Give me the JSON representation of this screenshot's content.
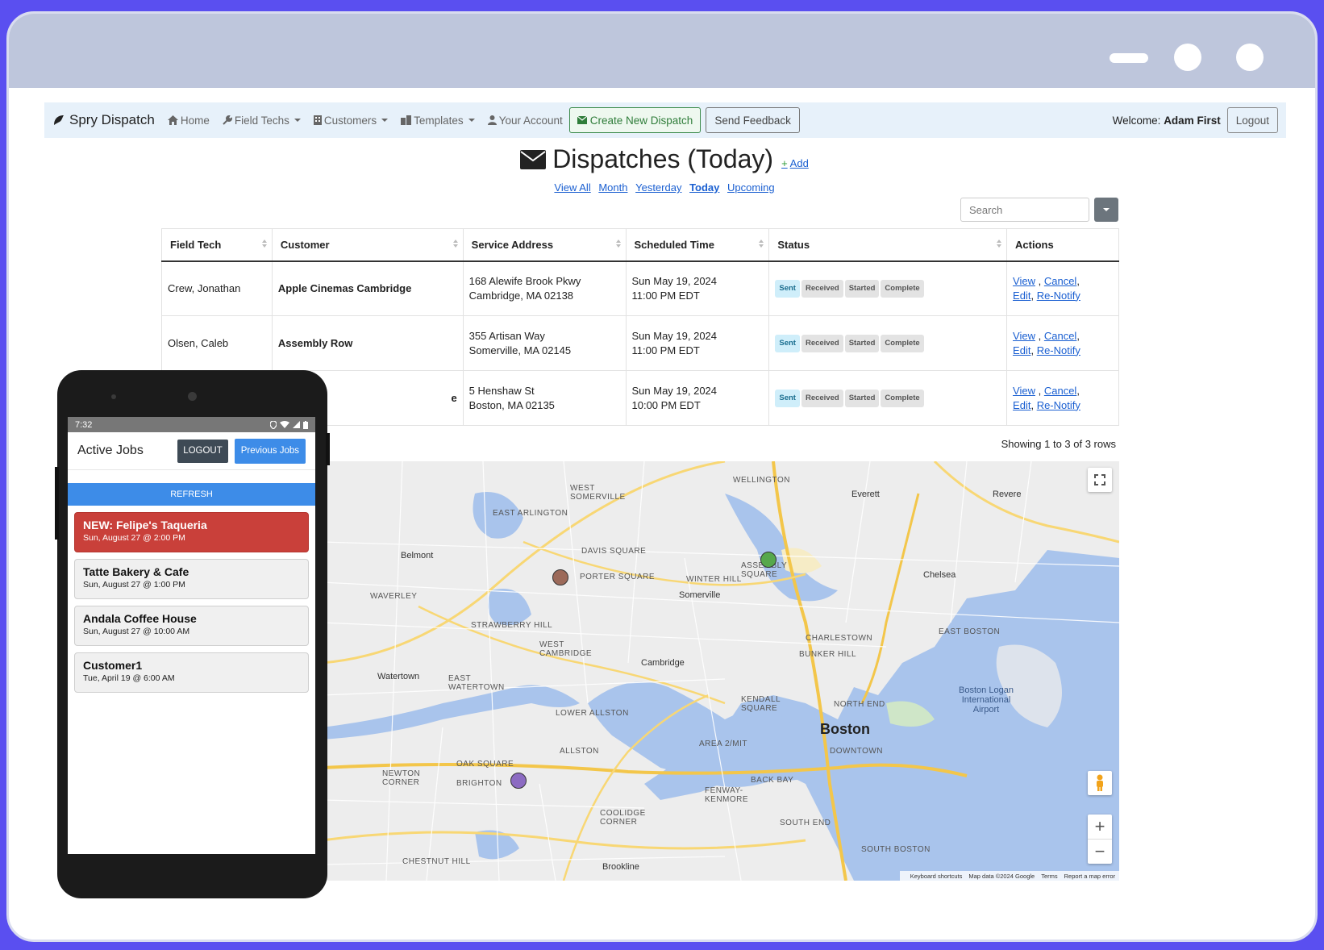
{
  "navbar": {
    "brand": "Spry Dispatch",
    "items": [
      {
        "label": "Home",
        "icon": "home-icon"
      },
      {
        "label": "Field Techs",
        "icon": "wrench-icon"
      },
      {
        "label": "Customers",
        "icon": "building-icon"
      },
      {
        "label": "Templates",
        "icon": "template-icon"
      },
      {
        "label": "Your Account",
        "icon": "user-icon"
      }
    ],
    "create_label": "Create New Dispatch",
    "feedback_label": "Send Feedback",
    "welcome_prefix": "Welcome:",
    "welcome_user": "Adam First",
    "logout_label": "Logout"
  },
  "page": {
    "title": "Dispatches (Today)",
    "add_label": "Add",
    "filters": [
      "View All",
      "Month",
      "Yesterday",
      "Today",
      "Upcoming"
    ],
    "active_filter": "Today"
  },
  "search": {
    "placeholder": "Search"
  },
  "table": {
    "headers": [
      "Field Tech",
      "Customer",
      "Service Address",
      "Scheduled Time",
      "Status",
      "Actions"
    ],
    "rows": [
      {
        "tech": "Crew, Jonathan",
        "customer": "Apple Cinemas Cambridge",
        "addr1": "168 Alewife Brook Pkwy",
        "addr2": "Cambridge, MA 02138",
        "date": "Sun May 19, 2024",
        "time": "11:00 PM EDT"
      },
      {
        "tech": "Olsen, Caleb",
        "customer": "Assembly Row",
        "addr1": "355 Artisan Way",
        "addr2": "Somerville, MA 02145",
        "date": "Sun May 19, 2024",
        "time": "11:00 PM EDT"
      },
      {
        "tech": "",
        "customer": "e",
        "addr1": "5 Henshaw St",
        "addr2": "Boston, MA 02135",
        "date": "Sun May 19, 2024",
        "time": "10:00 PM EDT"
      }
    ],
    "statuses": [
      "Sent",
      "Received",
      "Started",
      "Complete"
    ],
    "actions": {
      "view": "View",
      "cancel": "Cancel",
      "edit": "Edit",
      "renotify": "Re-Notify"
    },
    "showing": "Showing 1 to 3 of 3 rows"
  },
  "map": {
    "labels": {
      "boston": "Boston",
      "cambridge": "Cambridge",
      "somerville": "Somerville",
      "everett": "Everett",
      "chelsea": "Chelsea",
      "revere": "Revere",
      "belmont": "Belmont",
      "watertown": "Watertown",
      "brookline": "Brookline",
      "airport": "Boston Logan International Airport",
      "davis": "DAVIS SQUARE",
      "porter": "PORTER SQUARE",
      "assembly": "ASSEMBLY SQUARE",
      "charlestown": "CHARLESTOWN",
      "kendall": "KENDALL SQUARE",
      "northend": "NORTH END",
      "downtown": "DOWNTOWN",
      "backbay": "BACK BAY",
      "fenway": "FENWAY-KENMORE",
      "allston": "ALLSTON",
      "brighton": "BRIGHTON",
      "southend": "SOUTH END",
      "southboston": "SOUTH BOSTON",
      "eastboston": "EAST BOSTON",
      "wellington": "WELLINGTON",
      "eastarlington": "EAST ARLINGTON",
      "westsomerville": "WEST SOMERVILLE",
      "winterhill": "WINTER HILL",
      "strawberry": "STRAWBERRY HILL",
      "westcambridge": "WEST CAMBRIDGE",
      "lowerallston": "LOWER ALLSTON",
      "eastwatertown": "EAST WATERTOWN",
      "oaksquare": "OAK SQUARE",
      "chestnut": "CHESTNUT HILL",
      "coolidge": "COOLIDGE CORNER",
      "waverley": "WAVERLEY",
      "bunker": "BUNKER HILL",
      "newton": "NEWTON CORNER",
      "mit": "AREA 2/MIT"
    },
    "markers": [
      {
        "name": "marker-brown",
        "color": "#9c6a5a"
      },
      {
        "name": "marker-green",
        "color": "#56a84b"
      },
      {
        "name": "marker-purple",
        "color": "#8c6bc2"
      }
    ],
    "footer": [
      "Keyboard shortcuts",
      "Map data ©2024 Google",
      "Terms",
      "Report a map error"
    ]
  },
  "phone": {
    "time": "7:32",
    "title": "Active Jobs",
    "logout": "LOGOUT",
    "previous": "Previous Jobs",
    "refresh": "REFRESH",
    "jobs": [
      {
        "title": "NEW: Felipe's Taqueria",
        "date": "Sun, August 27 @ 2:00 PM"
      },
      {
        "title": "Tatte Bakery & Cafe",
        "date": "Sun, August 27 @ 1:00 PM"
      },
      {
        "title": "Andala Coffee House",
        "date": "Sun, August 27 @ 10:00 AM"
      },
      {
        "title": "Customer1",
        "date": "Tue, April 19 @ 6:00 AM"
      }
    ]
  }
}
